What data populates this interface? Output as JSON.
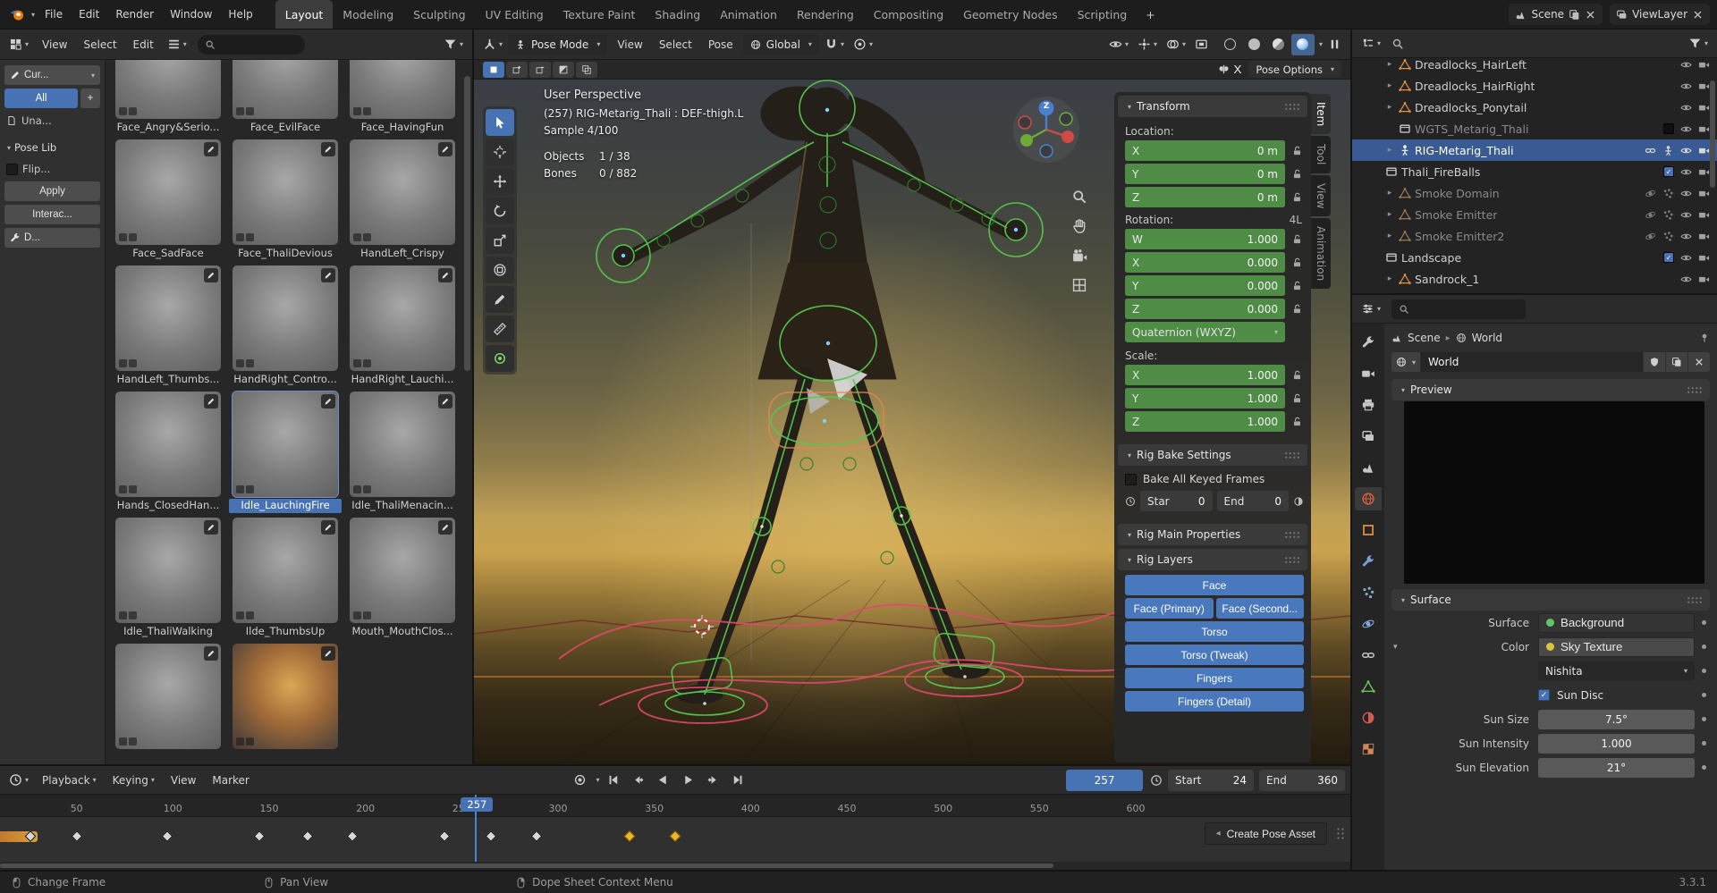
{
  "colors": {
    "accent_blue": "#4772b3",
    "keyframed_green": "#4f8c46",
    "selected_keyframe": "#f0b429",
    "mesh_orange": "#e8913f"
  },
  "topbar": {
    "menus": [
      "File",
      "Edit",
      "Render",
      "Window",
      "Help"
    ],
    "workspaces": [
      "Layout",
      "Modeling",
      "Sculpting",
      "UV Editing",
      "Texture Paint",
      "Shading",
      "Animation",
      "Rendering",
      "Compositing",
      "Geometry Nodes",
      "Scripting"
    ],
    "active_workspace": "Layout",
    "add_workspace": "+",
    "scene_label": "Scene",
    "viewlayer_label": "ViewLayer"
  },
  "asset_browser": {
    "menus": [
      "View",
      "Select",
      "Edit"
    ],
    "sidebar": {
      "library": "Cur...",
      "all": "All",
      "add": "+",
      "unassigned": "Una...",
      "catalog": "Pose Lib",
      "flip": "Flip...",
      "apply": "Apply",
      "interactive": "Interac...",
      "tool": "D..."
    },
    "selected": "Idle_LauchingFire",
    "items": [
      {
        "label": "Face_Angry&Serio..."
      },
      {
        "label": "Face_EvilFace"
      },
      {
        "label": "Face_HavingFun"
      },
      {
        "label": "Face_SadFace"
      },
      {
        "label": "Face_ThaliDevious"
      },
      {
        "label": "HandLeft_Crispy"
      },
      {
        "label": "HandLeft_Thumbs..."
      },
      {
        "label": "HandRight_Contro..."
      },
      {
        "label": "HandRight_Lauchi..."
      },
      {
        "label": "Hands_ClosedHan..."
      },
      {
        "label": "Idle_LauchingFire"
      },
      {
        "label": "Idle_ThaliMenacin..."
      },
      {
        "label": "Idle_ThaliWalking"
      },
      {
        "label": "Ilde_ThumbsUp"
      },
      {
        "label": "Mouth_MouthClos..."
      },
      {
        "label": "",
        "variant": "plain"
      },
      {
        "label": "",
        "variant": "fire"
      }
    ]
  },
  "viewport": {
    "mode": "Pose Mode",
    "menus": [
      "View",
      "Select",
      "Pose"
    ],
    "orientation": "Global",
    "select_modes": [
      "new",
      "extend",
      "subtract",
      "invert",
      "intersect"
    ],
    "mirror_x": "X",
    "pose_options": "Pose Options",
    "tools": [
      "select-box",
      "cursor",
      "move",
      "rotate",
      "scale",
      "transform",
      "annotate",
      "measure",
      "pose-breakdowner"
    ],
    "active_tool": "select-box",
    "shading_modes": [
      "wireframe",
      "solid",
      "material-preview",
      "rendered"
    ],
    "active_shading": "rendered",
    "gizmo_z": "Z",
    "overlay": {
      "view": "User Perspective",
      "context": "(257) RIG-Metarig_Thali : DEF-thigh.L",
      "sample": "Sample 4/100",
      "objects_label": "Objects",
      "objects_value": "1 / 38",
      "bones_label": "Bones",
      "bones_value": "0 / 882"
    },
    "npanel": {
      "tabs": [
        "Item",
        "Tool",
        "View",
        "Animation"
      ],
      "active_tab": "Item",
      "transform_title": "Transform",
      "location_label": "Location:",
      "location": [
        {
          "axis": "X",
          "value": "0 m"
        },
        {
          "axis": "Y",
          "value": "0 m"
        },
        {
          "axis": "Z",
          "value": "0 m"
        }
      ],
      "rotation_label": "Rotation:",
      "rotation_badge": "4L",
      "rotation": [
        {
          "axis": "W",
          "value": "1.000"
        },
        {
          "axis": "X",
          "value": "0.000"
        },
        {
          "axis": "Y",
          "value": "0.000"
        },
        {
          "axis": "Z",
          "value": "0.000"
        }
      ],
      "rotation_mode": "Quaternion (WXYZ)",
      "scale_label": "Scale:",
      "scale": [
        {
          "axis": "X",
          "value": "1.000"
        },
        {
          "axis": "Y",
          "value": "1.000"
        },
        {
          "axis": "Z",
          "value": "1.000"
        }
      ],
      "rig_bake_title": "Rig Bake Settings",
      "bake_checkbox": "Bake All Keyed Frames",
      "bake_start_label": "Star",
      "bake_start_value": "0",
      "bake_end_label": "End",
      "bake_end_value": "0",
      "rig_main_title": "Rig Main Properties",
      "rig_layers_title": "Rig Layers",
      "rig_layers": [
        {
          "label": "Face",
          "w": "full"
        },
        {
          "label": "Face (Primary)",
          "w": "half"
        },
        {
          "label": "Face (Second...",
          "w": "half"
        },
        {
          "label": "Torso",
          "w": "full"
        },
        {
          "label": "Torso (Tweak)",
          "w": "full"
        },
        {
          "label": "Fingers",
          "w": "full"
        },
        {
          "label": "Fingers (Detail)",
          "w": "full"
        }
      ]
    }
  },
  "outliner": {
    "rows": [
      {
        "label": "Dreadlocks_HairLeft",
        "icon": "mesh",
        "arrow": true,
        "indent": 2
      },
      {
        "label": "Dreadlocks_HairRight",
        "icon": "mesh",
        "arrow": true,
        "indent": 2
      },
      {
        "label": "Dreadlocks_Ponytail",
        "icon": "mesh",
        "arrow": true,
        "indent": 2
      },
      {
        "label": "WGTS_Metarig_Thali",
        "icon": "collection",
        "arrow": false,
        "indent": 2,
        "dim": true,
        "checkbox": "empty"
      },
      {
        "label": "RIG-Metarig_Thali",
        "icon": "armature",
        "arrow": true,
        "indent": 2,
        "selected": true,
        "extras": [
          "chain",
          "person"
        ]
      },
      {
        "label": "Thali_FireBalls",
        "icon": "collection",
        "arrow": false,
        "indent": 1,
        "checkbox": "checked"
      },
      {
        "label": "Smoke Domain",
        "icon": "mesh",
        "arrow": true,
        "indent": 2,
        "dim": true,
        "extras": [
          "orbit",
          "particles"
        ]
      },
      {
        "label": "Smoke Emitter",
        "icon": "mesh",
        "arrow": true,
        "indent": 2,
        "dim": true,
        "extras": [
          "orbit",
          "particles"
        ]
      },
      {
        "label": "Smoke Emitter2",
        "icon": "mesh",
        "arrow": true,
        "indent": 2,
        "dim": true,
        "extras": [
          "orbit",
          "particles"
        ]
      },
      {
        "label": "Landscape",
        "icon": "collection",
        "arrow": false,
        "indent": 1,
        "checkbox": "checked"
      },
      {
        "label": "Sandrock_1",
        "icon": "mesh",
        "arrow": true,
        "indent": 2
      }
    ]
  },
  "properties": {
    "tabs": [
      "tool",
      "render",
      "output",
      "view-layer",
      "scene",
      "world",
      "object",
      "modifiers",
      "particles",
      "physics",
      "constraints",
      "object-data",
      "material",
      "texture"
    ],
    "active_tab": "world",
    "breadcrumb_scene": "Scene",
    "breadcrumb_world": "World",
    "datablock_name": "World",
    "preview_title": "Preview",
    "surface_title": "Surface",
    "surface_label": "Surface",
    "surface_value": "Background",
    "color_label": "Color",
    "color_value": "Sky Texture",
    "sky_type": "Nishita",
    "sun_disc_label": "Sun Disc",
    "rows": [
      {
        "label": "Sun Size",
        "value": "7.5°"
      },
      {
        "label": "Sun Intensity",
        "value": "1.000"
      },
      {
        "label": "Sun Elevation",
        "value": "21°"
      }
    ]
  },
  "timeline": {
    "menus": [
      "Playback",
      "Keying",
      "View",
      "Marker"
    ],
    "transport": [
      "skip-first",
      "prev-keyframe",
      "reverse-play",
      "play",
      "next-keyframe",
      "skip-last"
    ],
    "current_frame": "257",
    "frame_badge": "257",
    "start_label": "Start",
    "start_value": "24",
    "end_label": "End",
    "end_value": "360",
    "ticks": [
      50,
      100,
      150,
      200,
      250,
      300,
      350,
      400,
      450,
      500,
      550,
      600
    ],
    "keyframes": [
      26,
      50,
      97,
      145,
      170,
      193,
      241,
      265,
      289,
      337,
      361
    ],
    "selected_keyframes": [
      337,
      361
    ],
    "create_pose_asset": "Create Pose Asset"
  },
  "statusbar": {
    "left_click": "Change Frame",
    "middle_click": "Pan View",
    "right_click": "Dope Sheet Context Menu",
    "version": "3.3.1"
  }
}
